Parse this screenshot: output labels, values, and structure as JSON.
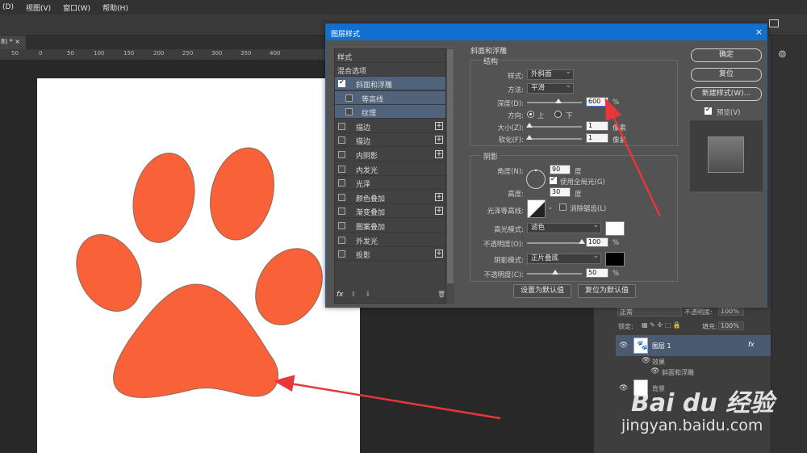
{
  "menubar": {
    "items": [
      "(D)",
      "视图(V)",
      "窗口(W)",
      "帮助(H)"
    ]
  },
  "document": {
    "tab_label": "8) * ×",
    "ruler_ticks": [
      "50",
      "0",
      "50",
      "100",
      "150",
      "200",
      "250",
      "300",
      "350",
      "400"
    ]
  },
  "dialog": {
    "title": "图层样式",
    "close": "×",
    "style_list": {
      "header": "样式",
      "blend": "混合选项",
      "items": [
        {
          "label": "斜面和浮雕",
          "checked": true,
          "selected": true,
          "plus": false
        },
        {
          "label": "等高线",
          "checked": false,
          "sub": true,
          "plus": false
        },
        {
          "label": "纹理",
          "checked": false,
          "sub": true,
          "plus": false
        },
        {
          "label": "描边",
          "checked": false,
          "plus": true
        },
        {
          "label": "描边",
          "checked": false,
          "plus": true
        },
        {
          "label": "内阴影",
          "checked": false,
          "plus": true
        },
        {
          "label": "内发光",
          "checked": false,
          "plus": false
        },
        {
          "label": "光泽",
          "checked": false,
          "plus": false
        },
        {
          "label": "颜色叠加",
          "checked": false,
          "plus": true
        },
        {
          "label": "渐变叠加",
          "checked": false,
          "plus": true
        },
        {
          "label": "图案叠加",
          "checked": false,
          "plus": false
        },
        {
          "label": "外发光",
          "checked": false,
          "plus": false
        },
        {
          "label": "投影",
          "checked": false,
          "plus": true
        }
      ],
      "footer": {
        "fx": "fx",
        "up": "⬆",
        "down": "⬇",
        "trash": "🗑"
      }
    },
    "bevel": {
      "section": "斜面和浮雕",
      "structure": "结构",
      "style_label": "样式:",
      "style_value": "外斜面",
      "method_label": "方法:",
      "method_value": "平滑",
      "depth_label": "深度(D):",
      "depth_value": "600",
      "depth_unit": "%",
      "direction_label": "方向:",
      "dir_up": "上",
      "dir_down": "下",
      "size_label": "大小(Z):",
      "size_value": "1",
      "size_unit": "像素",
      "soften_label": "软化(F):",
      "soften_value": "1",
      "soften_unit": "像素"
    },
    "shading": {
      "section": "阴影",
      "angle_label": "角度(N):",
      "angle_value": "90",
      "angle_unit": "度",
      "global_light": "使用全局光(G)",
      "altitude_label": "高度:",
      "altitude_value": "30",
      "altitude_unit": "度",
      "gloss_label": "光泽等高线:",
      "antialias": "消除锯齿(L)",
      "highlight_mode_label": "高光模式:",
      "highlight_mode": "滤色",
      "highlight_color": "#ffffff",
      "highlight_opacity_label": "不透明度(O):",
      "highlight_opacity": "100",
      "shadow_mode_label": "阴影模式:",
      "shadow_mode": "正片叠底",
      "shadow_color": "#000000",
      "shadow_opacity_label": "不透明度(C):",
      "shadow_opacity": "50",
      "pct": "%"
    },
    "footer_buttons": {
      "set_default": "设置为默认值",
      "reset_default": "复位为默认值"
    },
    "buttons": {
      "ok": "确定",
      "reset": "复位",
      "new_style": "新建样式(W)...",
      "preview": "预览(V)"
    }
  },
  "layers": {
    "blend_mode": "正常",
    "opacity_label": "不透明度:",
    "opacity_value": "100%",
    "lock_label": "锁定:",
    "fill_label": "填充:",
    "fill_value": "100%",
    "layer1": "图层 1",
    "effects": "效果",
    "effect_item": "斜面和浮雕",
    "background": "背景",
    "fx": "fx"
  },
  "watermark": {
    "logo": "Bai du 经验",
    "url": "jingyan.baidu.com"
  },
  "colors": {
    "paw": "#f96138",
    "accent": "#1170cf",
    "arrow": "#e8363a"
  }
}
